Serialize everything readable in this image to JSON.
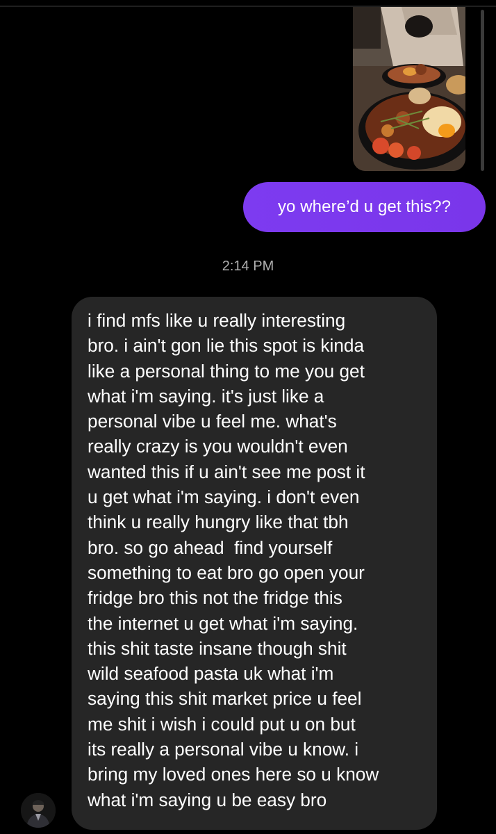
{
  "conversation": {
    "photo_message": {
      "icon": "food-photo"
    },
    "sent_message": {
      "text": "yo where’d u get this??"
    },
    "timestamp": "2:14 PM",
    "received_message": {
      "lines": [
        "i find mfs like u really interesting",
        "bro. i ain't gon lie this spot is kinda",
        "like a personal thing to me you get",
        "what i'm saying. it's just like a",
        "personal vibe u feel me. what's",
        "really crazy is you wouldn't even",
        "wanted this if u ain't see me post it",
        "u get what i'm saying. i don't even",
        "think u really hungry like that tbh",
        "bro. so go ahead  find yourself",
        "something to eat bro go open your",
        "fridge bro this not the fridge this",
        "the internet u get what i'm saying.",
        "this shit taste insane though shit",
        "wild seafood pasta uk what i'm",
        "saying this shit market price u feel",
        "me shit i wish i could put u on but",
        "its really a personal vibe u know. i",
        "bring my loved ones here so u know",
        "what i'm saying u be easy bro"
      ]
    },
    "sender_avatar": {
      "icon": "avatar"
    }
  },
  "colors": {
    "background": "#000000",
    "sent_bubble": "#7c3aed",
    "received_bubble": "#262626",
    "timestamp_text": "#b0b0b0"
  }
}
